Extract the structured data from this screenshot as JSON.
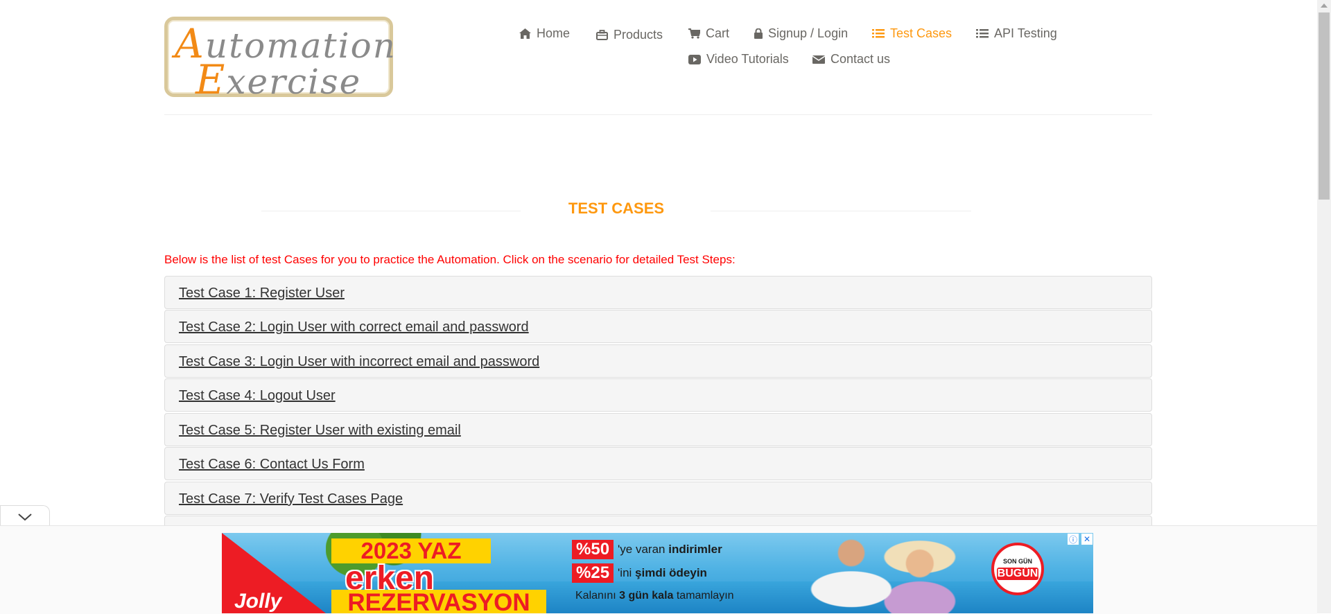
{
  "logo": {
    "line1_cap": "A",
    "line1_rest": "utomation",
    "line2_cap": "E",
    "line2_rest": "xercise"
  },
  "nav": {
    "items": [
      {
        "label": "Home",
        "icon": "home-icon"
      },
      {
        "label": "Products",
        "icon": "briefcase-icon"
      },
      {
        "label": "Cart",
        "icon": "cart-icon"
      },
      {
        "label": "Signup / Login",
        "icon": "lock-icon"
      },
      {
        "label": "Test Cases",
        "icon": "list-icon",
        "active": true
      },
      {
        "label": "API Testing",
        "icon": "list-icon"
      },
      {
        "label": "Video Tutorials",
        "icon": "youtube-icon"
      },
      {
        "label": "Contact us",
        "icon": "envelope-icon"
      }
    ]
  },
  "page": {
    "title": "TEST CASES",
    "intro": "Below is the list of test Cases for you to practice the Automation. Click on the scenario for detailed Test Steps:"
  },
  "test_cases": [
    "Test Case 1: Register User",
    "Test Case 2: Login User with correct email and password",
    "Test Case 3: Login User with incorrect email and password",
    "Test Case 4: Logout User",
    "Test Case 5: Register User with existing email",
    "Test Case 6: Contact Us Form",
    "Test Case 7: Verify Test Cases Page"
  ],
  "ad": {
    "brand": "Jolly",
    "headline_1": "2023 YAZ",
    "headline_2": "erken",
    "headline_3": "REZERVASYON",
    "offer_1_pct": "%50",
    "offer_1_pre": "'ye varan ",
    "offer_1_bold": "indirimler",
    "offer_2_pct": "%25",
    "offer_2_pre": "'ini ",
    "offer_2_bold": "şimdi ödeyin",
    "offer_3_pre": "Kalanını ",
    "offer_3_bold": "3 gün kala",
    "offer_3_post": " tamamlayın",
    "badge_top": "SON GÜN",
    "badge_main": "BUGÜN",
    "info_icon": "info-icon",
    "close_icon": "close-icon"
  },
  "colors": {
    "accent": "#fe980f",
    "intro_text": "#ff0000",
    "nav_text": "#696763"
  }
}
